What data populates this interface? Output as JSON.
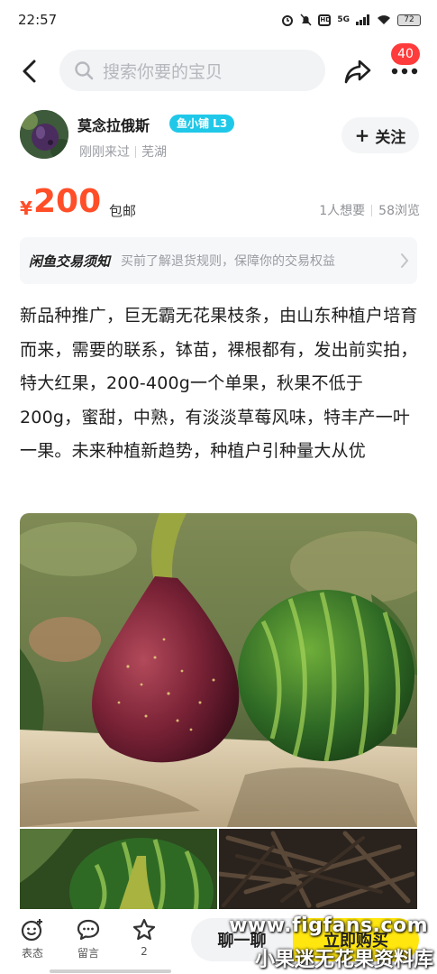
{
  "status_bar": {
    "time": "22:57",
    "battery": "72",
    "network": "5G"
  },
  "header": {
    "search_placeholder": "搜索你要的宝贝",
    "notification_count": "40"
  },
  "seller": {
    "name": "莫念拉俄斯",
    "level": "鱼小铺 L3",
    "last_seen": "刚刚来过",
    "location": "芜湖",
    "follow_label": "关注"
  },
  "product": {
    "currency": "¥",
    "price": "200",
    "shipping": "包邮",
    "wants": "1人想要",
    "views": "58浏览",
    "description": "新品种推广，巨无霸无花果枝条，由山东种植户培育而来，需要的联系，钵苗，裸根都有，发出前实拍，特大红果，200-400g一个单果，秋果不低于200g，蜜甜，中熟，有淡淡草莓风味，特丰产一叶一果。未来种植新趋势，种植户引种量大从优"
  },
  "notice": {
    "title": "闲鱼交易须知",
    "text": "买前了解退货规则，保障你的交易权益"
  },
  "bottom_bar": {
    "emoji_label": "表态",
    "comment_label": "留言",
    "fav_count": "2",
    "chat_label": "聊一聊",
    "buy_label": "立即购买"
  },
  "watermark": {
    "url": "www.figfans.com",
    "name": "小果迷无花果资料库"
  },
  "colors": {
    "price": "#ff4e28",
    "buy_button": "#ffe60f",
    "level_badge": "#1fc8e8",
    "notif_badge": "#ff3b3b"
  }
}
